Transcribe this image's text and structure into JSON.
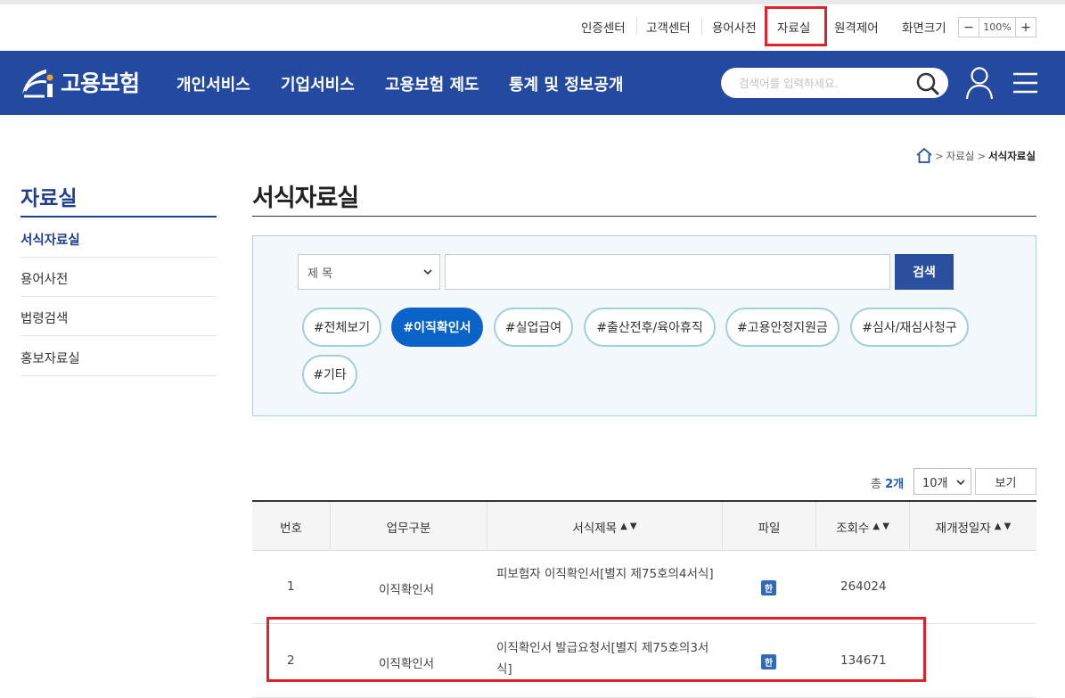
{
  "util_menu": [
    "인증센터",
    "고객센터",
    "용어사전",
    "자료실",
    "원격제어",
    "화면크기"
  ],
  "zoom": {
    "minus": "−",
    "value": "100%",
    "plus": "+"
  },
  "logo": {
    "text": "고용보험"
  },
  "nav": [
    "개인서비스",
    "기업서비스",
    "고용보험 제도",
    "통계 및 정보공개"
  ],
  "search": {
    "placeholder": "검색어를 입력하세요."
  },
  "breadcrumb": {
    "items": [
      "자료실",
      "서식자료실"
    ]
  },
  "sidebar": {
    "title": "자료실",
    "items": [
      "서식자료실",
      "용어사전",
      "법령검색",
      "홍보자료실"
    ]
  },
  "page_title": "서식자료실",
  "filter": {
    "select_value": "제 목",
    "search_button": "검색",
    "tags": [
      "#전체보기",
      "#이직확인서",
      "#실업급여",
      "#출산전후/육아휴직",
      "#고용안정지원금",
      "#심사/재심사청구",
      "#기타"
    ]
  },
  "list": {
    "total_prefix": "총",
    "total_count": "2개",
    "page_size": "10개",
    "view_button": "보기"
  },
  "table": {
    "headers": [
      "번호",
      "업무구분",
      "서식제목",
      "파일",
      "조회수",
      "재개정일자"
    ],
    "sort_arrows": "▲ ▼",
    "rows": [
      {
        "no": "1",
        "category": "이직확인서",
        "title": "피보험자 이직확인서[별지 제75호의4서식]",
        "file": "한",
        "views": "264024",
        "date": ""
      },
      {
        "no": "2",
        "category": "이직확인서",
        "title": "이직확인서 발급요청서[별지 제75호의3서식]",
        "file": "한",
        "views": "134671",
        "date": ""
      }
    ]
  },
  "colors": {
    "nav_bg": "#234a9f",
    "accent": "#1d3f8f",
    "tag_active": "#0a63c9",
    "highlight": "#e0212b"
  }
}
